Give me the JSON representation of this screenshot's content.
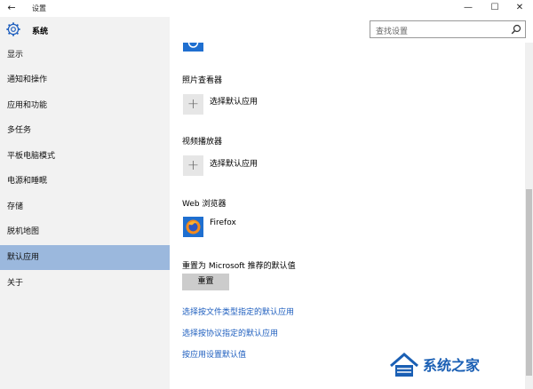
{
  "window": {
    "title": "设置",
    "controls": {
      "minimize": "—",
      "maximize": "☐",
      "close": "✕"
    }
  },
  "sidebar": {
    "title": "系统",
    "items": [
      {
        "label": "显示",
        "active": false
      },
      {
        "label": "通知和操作",
        "active": false
      },
      {
        "label": "应用和功能",
        "active": false
      },
      {
        "label": "多任务",
        "active": false
      },
      {
        "label": "平板电脑模式",
        "active": false
      },
      {
        "label": "电源和睡眠",
        "active": false
      },
      {
        "label": "存储",
        "active": false
      },
      {
        "label": "脱机地图",
        "active": false
      },
      {
        "label": "默认应用",
        "active": true
      },
      {
        "label": "关于",
        "active": false
      }
    ]
  },
  "search": {
    "placeholder": "查找设置"
  },
  "main": {
    "photo_viewer": {
      "heading": "照片查看器",
      "choose_label": "选择默认应用"
    },
    "video_player": {
      "heading": "视频播放器",
      "choose_label": "选择默认应用"
    },
    "web_browser": {
      "heading": "Web 浏览器",
      "app_name": "Firefox"
    },
    "reset": {
      "heading": "重置为 Microsoft 推荐的默认值",
      "button_label": "重置"
    },
    "links": [
      "选择按文件类型指定的默认应用",
      "选择按协议指定的默认应用",
      "按应用设置默认值"
    ]
  },
  "watermark": {
    "text": "系统之家"
  },
  "colors": {
    "accent": "#9bb8dd",
    "link": "#1f5fbf",
    "sidebar_bg": "#f2f2f2"
  }
}
